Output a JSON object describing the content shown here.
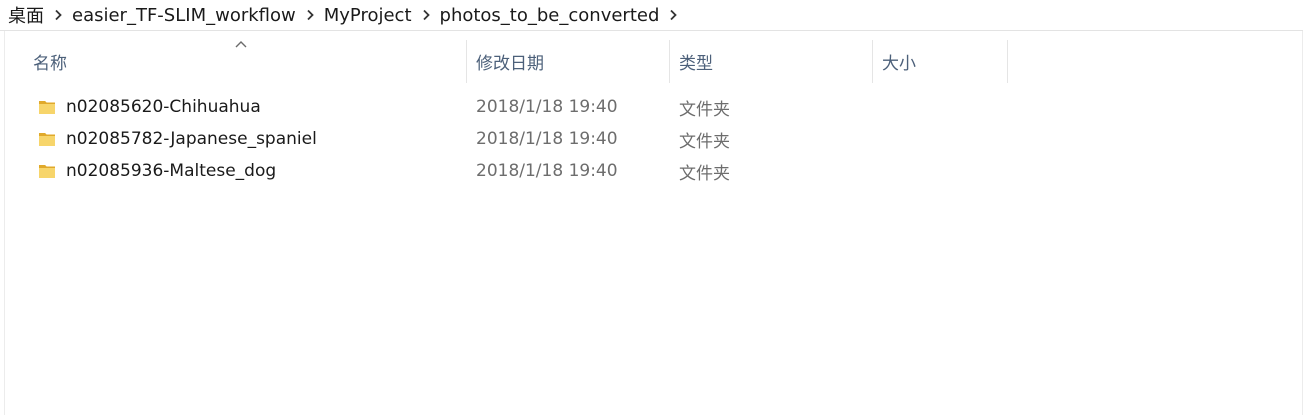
{
  "breadcrumb": {
    "items": [
      "桌面",
      "easier_TF-SLIM_workflow",
      "MyProject",
      "photos_to_be_converted"
    ]
  },
  "columns": {
    "name": "名称",
    "date": "修改日期",
    "type": "类型",
    "size": "大小"
  },
  "files": [
    {
      "name": "n02085620-Chihuahua",
      "date": "2018/1/18 19:40",
      "type": "文件夹",
      "size": ""
    },
    {
      "name": "n02085782-Japanese_spaniel",
      "date": "2018/1/18 19:40",
      "type": "文件夹",
      "size": ""
    },
    {
      "name": "n02085936-Maltese_dog",
      "date": "2018/1/18 19:40",
      "type": "文件夹",
      "size": ""
    }
  ],
  "colors": {
    "folder": "#f2c94c",
    "folder_dark": "#e0a92b",
    "header_text": "#4c607a",
    "meta_text": "#6d6d6d"
  },
  "icons": {
    "breadcrumb_separator": "chevron-right-icon",
    "sort_indicator": "sort-ascending-icon",
    "folder": "folder-icon"
  }
}
